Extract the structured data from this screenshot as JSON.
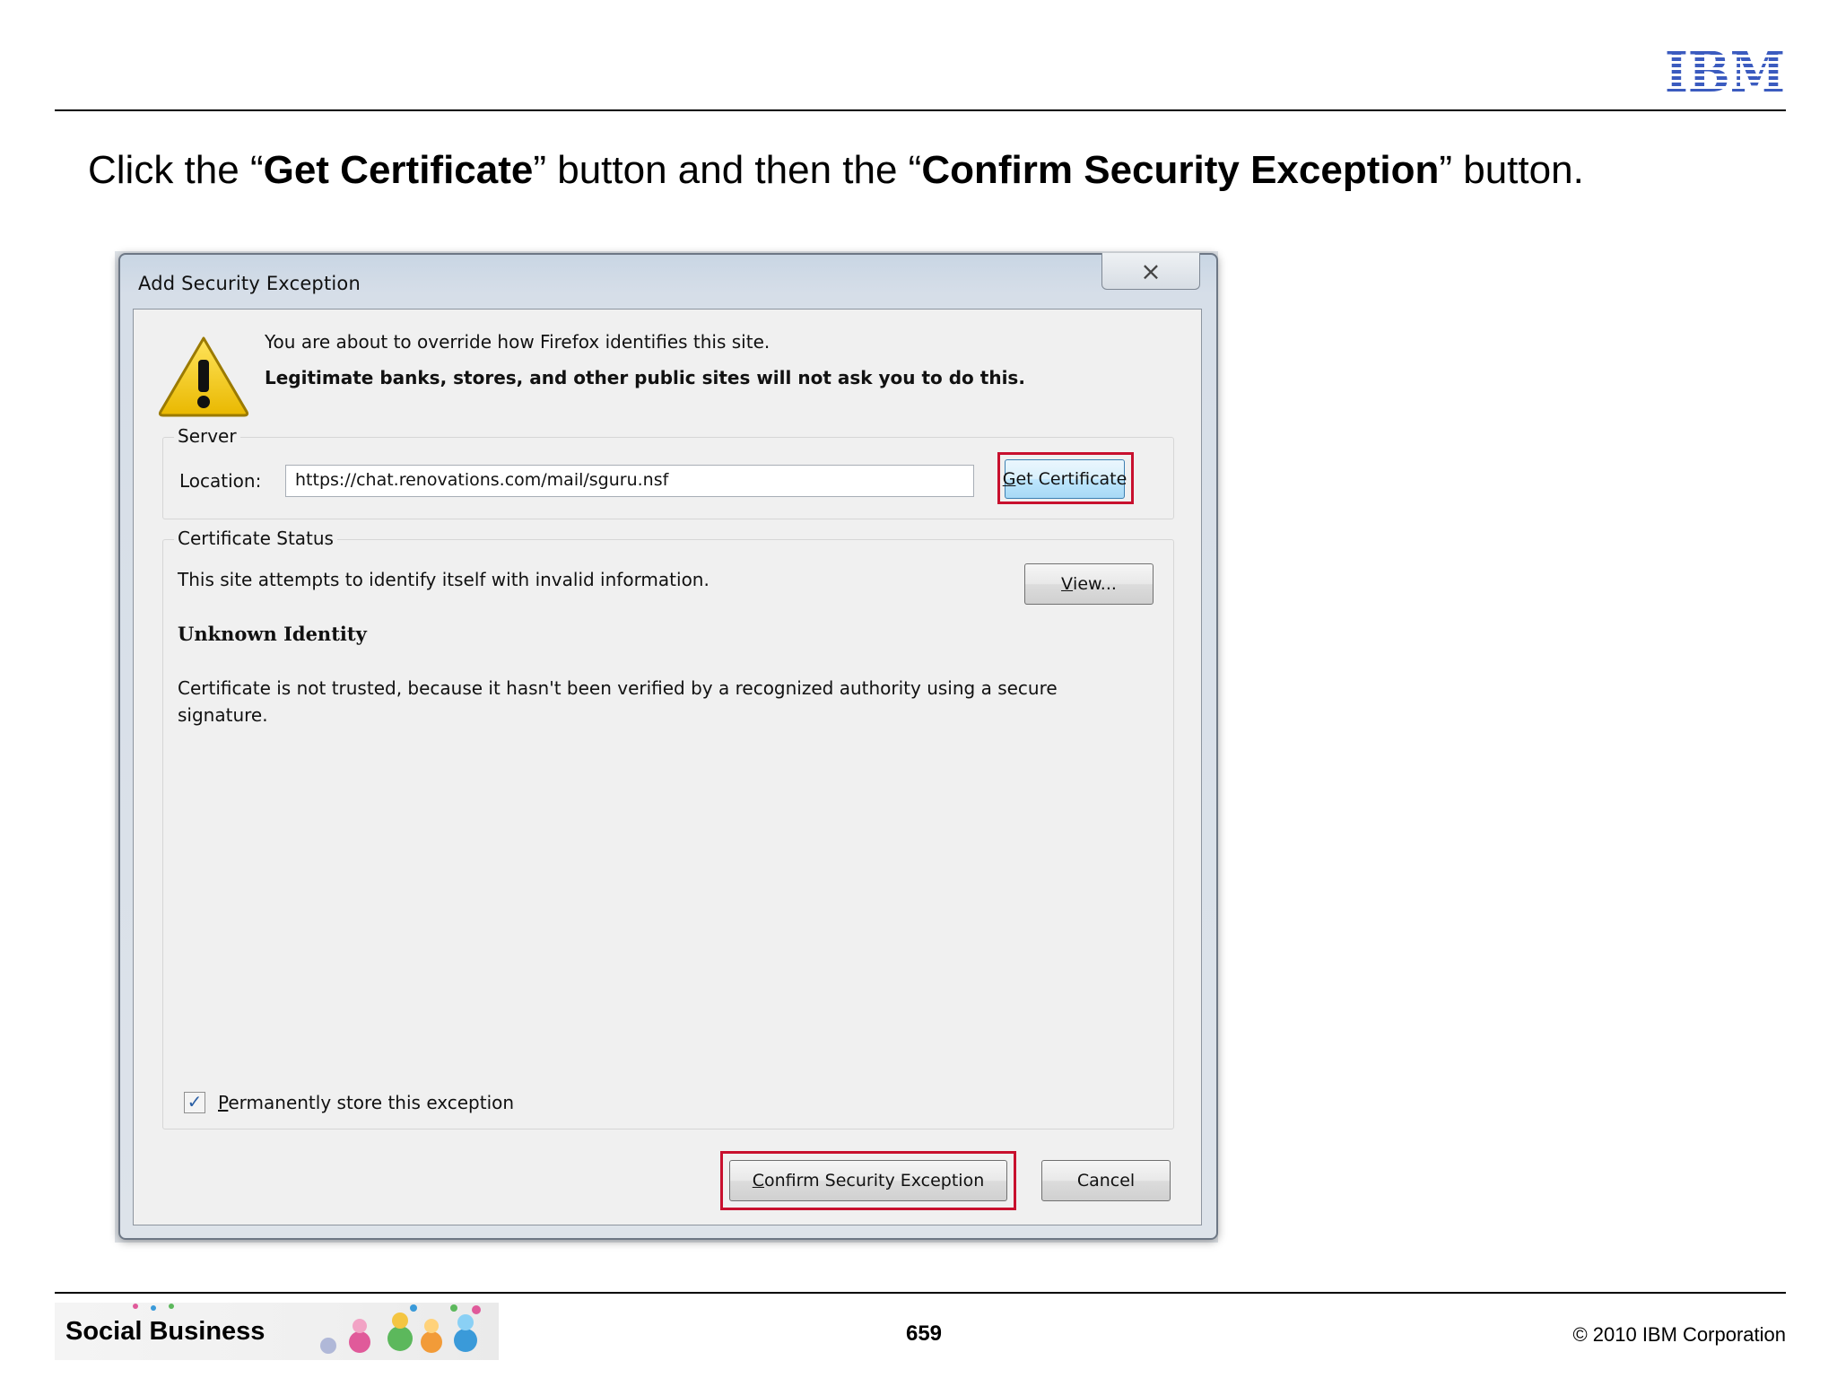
{
  "slide": {
    "logo_text": "IBM",
    "instruction": {
      "p1": "Click the “",
      "b1": "Get Certificate",
      "p2": "” button and then the “",
      "b2": "Confirm Security Exception",
      "p3": "” button."
    },
    "footer": {
      "banner_text": "Social Business",
      "page_number": "659",
      "copyright": "© 2010 IBM Corporation"
    }
  },
  "dialog": {
    "title": "Add Security Exception",
    "close_icon": "close-icon",
    "warning_icon": "warning-icon",
    "message_line1": "You are about to override how Firefox identifies this site.",
    "message_line2": "Legitimate banks, stores, and other public sites will not ask you to do this.",
    "server": {
      "group_label": "Server",
      "location_label": "Location:",
      "location_value": "https://chat.renovations.com/mail/sguru.nsf",
      "get_certificate_key": "G",
      "get_certificate_rest": "et Certificate"
    },
    "certificate_status": {
      "group_label": "Certificate Status",
      "status_text": "This site attempts to identify itself with invalid information.",
      "view_key": "V",
      "view_rest": "iew...",
      "identity_heading": "Unknown Identity",
      "detail_text": "Certificate is not trusted, because it hasn't been verified by a recognized authority using a secure signature."
    },
    "permanent_store": {
      "checked": true,
      "label_key": "P",
      "label_rest": "ermanently store this exception"
    },
    "buttons": {
      "confirm_key": "C",
      "confirm_rest": "onfirm Security Exception",
      "cancel": "Cancel"
    },
    "colors": {
      "highlight": "#c8102e",
      "ibm_blue": "#1f70c1"
    }
  }
}
